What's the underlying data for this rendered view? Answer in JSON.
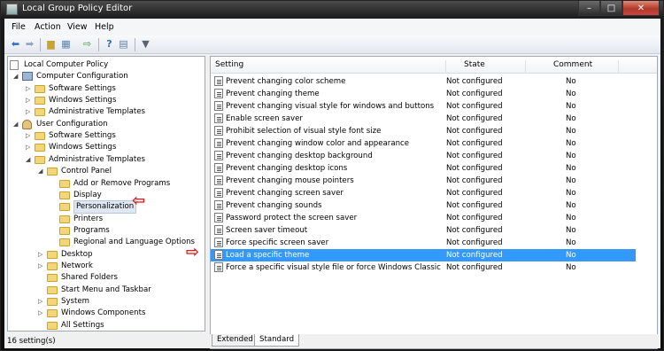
{
  "window": {
    "title": "Local Group Policy Editor",
    "buttons": [
      "–",
      "□",
      "✕"
    ]
  },
  "menu": [
    "File",
    "Action",
    "View",
    "Help"
  ],
  "toolbar": {
    "icons": [
      "back-icon",
      "forward-icon",
      "up-folder-icon",
      "show-hide-tree-icon",
      "export-list-icon",
      "help-icon",
      "properties-icon",
      "filter-icon"
    ]
  },
  "tree": [
    {
      "label": "Local Computer Policy",
      "level": 0,
      "icon": "doc",
      "arrow": ""
    },
    {
      "label": "Computer Configuration",
      "level": 1,
      "icon": "computer",
      "arrow": "◢"
    },
    {
      "label": "Software Settings",
      "level": 2,
      "icon": "folder",
      "arrow": "▷"
    },
    {
      "label": "Windows Settings",
      "level": 2,
      "icon": "folder",
      "arrow": "▷"
    },
    {
      "label": "Administrative Templates",
      "level": 2,
      "icon": "folder",
      "arrow": "▷"
    },
    {
      "label": "User Configuration",
      "level": 1,
      "icon": "user",
      "arrow": "◢"
    },
    {
      "label": "Software Settings",
      "level": 2,
      "icon": "folder",
      "arrow": "▷"
    },
    {
      "label": "Windows Settings",
      "level": 2,
      "icon": "folder",
      "arrow": "▷"
    },
    {
      "label": "Administrative Templates",
      "level": 2,
      "icon": "folder",
      "arrow": "◢"
    },
    {
      "label": "Control Panel",
      "level": 3,
      "icon": "folder",
      "arrow": "◢"
    },
    {
      "label": "Add or Remove Programs",
      "level": 4,
      "icon": "folder",
      "arrow": ""
    },
    {
      "label": "Display",
      "level": 4,
      "icon": "folder",
      "arrow": ""
    },
    {
      "label": "Personalization",
      "level": 4,
      "icon": "folder",
      "arrow": "",
      "selected": true
    },
    {
      "label": "Printers",
      "level": 4,
      "icon": "folder",
      "arrow": ""
    },
    {
      "label": "Programs",
      "level": 4,
      "icon": "folder",
      "arrow": ""
    },
    {
      "label": "Regional and Language Options",
      "level": 4,
      "icon": "folder",
      "arrow": ""
    },
    {
      "label": "Desktop",
      "level": 3,
      "icon": "folder",
      "arrow": "▷"
    },
    {
      "label": "Network",
      "level": 3,
      "icon": "folder",
      "arrow": "▷"
    },
    {
      "label": "Shared Folders",
      "level": 3,
      "icon": "folder",
      "arrow": ""
    },
    {
      "label": "Start Menu and Taskbar",
      "level": 3,
      "icon": "folder",
      "arrow": ""
    },
    {
      "label": "System",
      "level": 3,
      "icon": "folder",
      "arrow": "▷"
    },
    {
      "label": "Windows Components",
      "level": 3,
      "icon": "folder",
      "arrow": "▷"
    },
    {
      "label": "All Settings",
      "level": 3,
      "icon": "folder",
      "arrow": ""
    }
  ],
  "list": {
    "columns": [
      "Setting",
      "State",
      "Comment"
    ],
    "rows": [
      {
        "setting": "Prevent changing color scheme",
        "state": "Not configured",
        "comment": "No"
      },
      {
        "setting": "Prevent changing theme",
        "state": "Not configured",
        "comment": "No"
      },
      {
        "setting": "Prevent changing visual style for windows and buttons",
        "state": "Not configured",
        "comment": "No"
      },
      {
        "setting": "Enable screen saver",
        "state": "Not configured",
        "comment": "No"
      },
      {
        "setting": "Prohibit selection of visual style font size",
        "state": "Not configured",
        "comment": "No"
      },
      {
        "setting": "Prevent changing window color and appearance",
        "state": "Not configured",
        "comment": "No"
      },
      {
        "setting": "Prevent changing desktop background",
        "state": "Not configured",
        "comment": "No"
      },
      {
        "setting": "Prevent changing desktop icons",
        "state": "Not configured",
        "comment": "No"
      },
      {
        "setting": "Prevent changing mouse pointers",
        "state": "Not configured",
        "comment": "No"
      },
      {
        "setting": "Prevent changing screen saver",
        "state": "Not configured",
        "comment": "No"
      },
      {
        "setting": "Prevent changing sounds",
        "state": "Not configured",
        "comment": "No"
      },
      {
        "setting": "Password protect the screen saver",
        "state": "Not configured",
        "comment": "No"
      },
      {
        "setting": "Screen saver timeout",
        "state": "Not configured",
        "comment": "No"
      },
      {
        "setting": "Force specific screen saver",
        "state": "Not configured",
        "comment": "No"
      },
      {
        "setting": "Load a specific theme",
        "state": "Not configured",
        "comment": "No",
        "selected": true
      },
      {
        "setting": "Force a specific visual style file or force Windows Classic",
        "state": "Not configured",
        "comment": "No"
      }
    ]
  },
  "tabs": [
    "Extended",
    "Standard"
  ],
  "status": "16 setting(s)",
  "colors": {
    "selection": "#3399ff",
    "annotation_arrow": "#e01515"
  }
}
